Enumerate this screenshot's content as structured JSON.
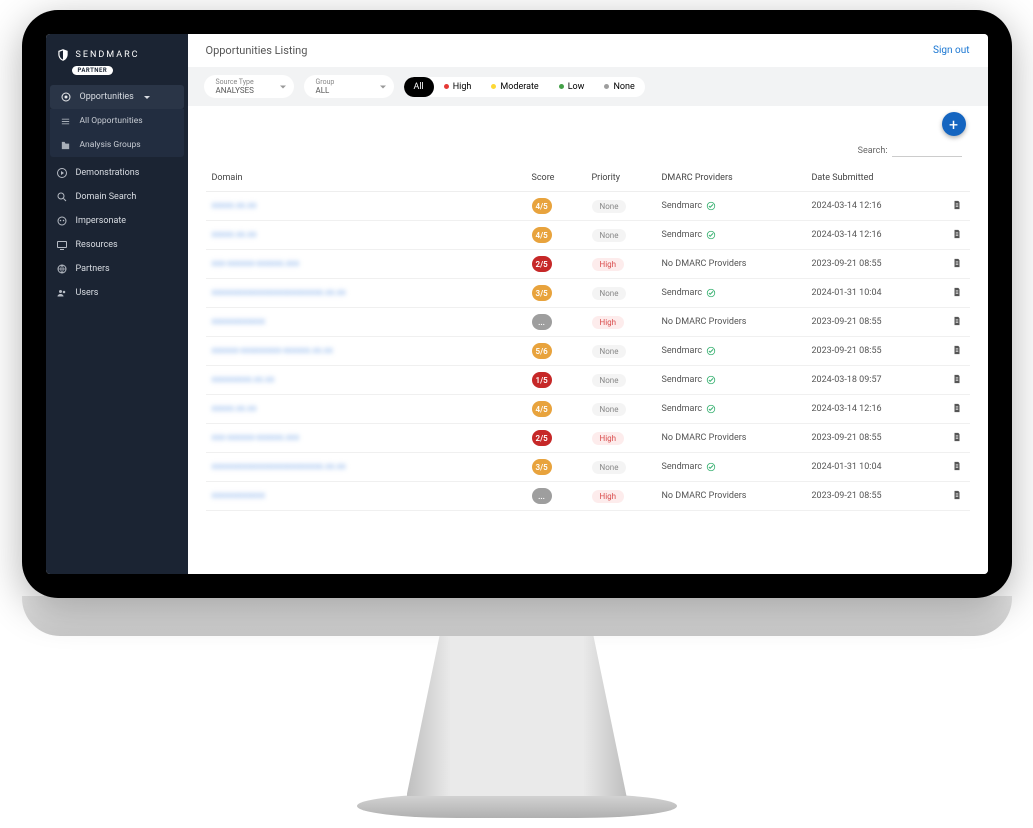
{
  "brand": {
    "name": "SENDMARC",
    "badge": "PARTNER"
  },
  "sidebar": {
    "opportunities": "Opportunities",
    "all_opportunities": "All Opportunities",
    "analysis_groups": "Analysis Groups",
    "demonstrations": "Demonstrations",
    "domain_search": "Domain Search",
    "impersonate": "Impersonate",
    "resources": "Resources",
    "partners": "Partners",
    "users": "Users"
  },
  "header": {
    "title": "Opportunities Listing",
    "signout": "Sign out"
  },
  "filters": {
    "source_type_label": "Source Type",
    "source_type_value": "ANALYSES",
    "group_label": "Group",
    "group_value": "ALL",
    "pills": {
      "all": "All",
      "high": "High",
      "moderate": "Moderate",
      "low": "Low",
      "none": "None"
    }
  },
  "fab": "+",
  "search_label": "Search:",
  "table": {
    "headers": {
      "domain": "Domain",
      "score": "Score",
      "priority": "Priority",
      "providers": "DMARC Providers",
      "submitted": "Date Submitted"
    },
    "rows": [
      {
        "domain": "xxxxx.xx.xx",
        "score": "4/5",
        "score_color": "orange",
        "priority": "None",
        "provider": "Sendmarc",
        "verified": true,
        "submitted": "2024-03-14 12:16"
      },
      {
        "domain": "xxxxx.xx.xx",
        "score": "4/5",
        "score_color": "orange",
        "priority": "None",
        "provider": "Sendmarc",
        "verified": true,
        "submitted": "2024-03-14 12:16"
      },
      {
        "domain": "xxx-xxxxxx-xxxxxx.xxx",
        "score": "2/5",
        "score_color": "red",
        "priority": "High",
        "provider": "No DMARC Providers",
        "verified": false,
        "submitted": "2023-09-21 08:55"
      },
      {
        "domain": "xxxxxxxxxxxxxxxxxxxxxxxxx.xx.xx",
        "score": "3/5",
        "score_color": "orange",
        "priority": "None",
        "provider": "Sendmarc",
        "verified": true,
        "submitted": "2024-01-31 10:04"
      },
      {
        "domain": "xxxxxxxxxxxx",
        "score": "...",
        "score_color": "gray",
        "priority": "High",
        "provider": "No DMARC Providers",
        "verified": false,
        "submitted": "2023-09-21 08:55"
      },
      {
        "domain": "xxxxxx-xxxxxxxxx-xxxxxx.xx.xx",
        "score": "5/6",
        "score_color": "orange",
        "priority": "None",
        "provider": "Sendmarc",
        "verified": true,
        "submitted": "2023-09-21 08:55"
      },
      {
        "domain": "xxxxxxxxx.xx.xx",
        "score": "1/5",
        "score_color": "red",
        "priority": "None",
        "provider": "Sendmarc",
        "verified": true,
        "submitted": "2024-03-18 09:57"
      },
      {
        "domain": "xxxxx.xx.xx",
        "score": "4/5",
        "score_color": "orange",
        "priority": "None",
        "provider": "Sendmarc",
        "verified": true,
        "submitted": "2024-03-14 12:16"
      },
      {
        "domain": "xxx-xxxxxx-xxxxxx.xxx",
        "score": "2/5",
        "score_color": "red",
        "priority": "High",
        "provider": "No DMARC Providers",
        "verified": false,
        "submitted": "2023-09-21 08:55"
      },
      {
        "domain": "xxxxxxxxxxxxxxxxxxxxxxxxx.xx.xx",
        "score": "3/5",
        "score_color": "orange",
        "priority": "None",
        "provider": "Sendmarc",
        "verified": true,
        "submitted": "2024-01-31 10:04"
      },
      {
        "domain": "xxxxxxxxxxxx",
        "score": "...",
        "score_color": "gray",
        "priority": "High",
        "provider": "No DMARC Providers",
        "verified": false,
        "submitted": "2023-09-21 08:55"
      }
    ]
  }
}
